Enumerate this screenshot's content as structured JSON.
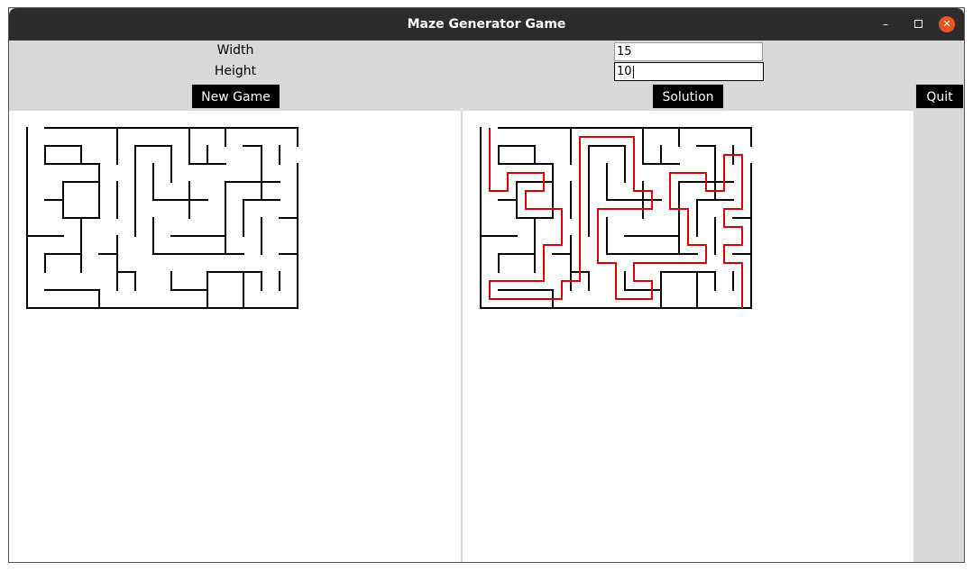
{
  "window": {
    "title": "Maze Generator Game"
  },
  "controls": {
    "width_label": "Width",
    "height_label": "Height",
    "width_value": "15",
    "height_value": "10",
    "new_game_label": "New Game",
    "solution_label": "Solution",
    "quit_label": "Quit"
  },
  "icons": {
    "minimize": "minimize-icon",
    "maximize": "maximize-icon",
    "close": "close-icon"
  },
  "colors": {
    "close_button": "#e95420",
    "solution_path": "#d40000",
    "maze_wall": "#000000"
  },
  "maze": {
    "cols": 15,
    "rows": 10
  }
}
